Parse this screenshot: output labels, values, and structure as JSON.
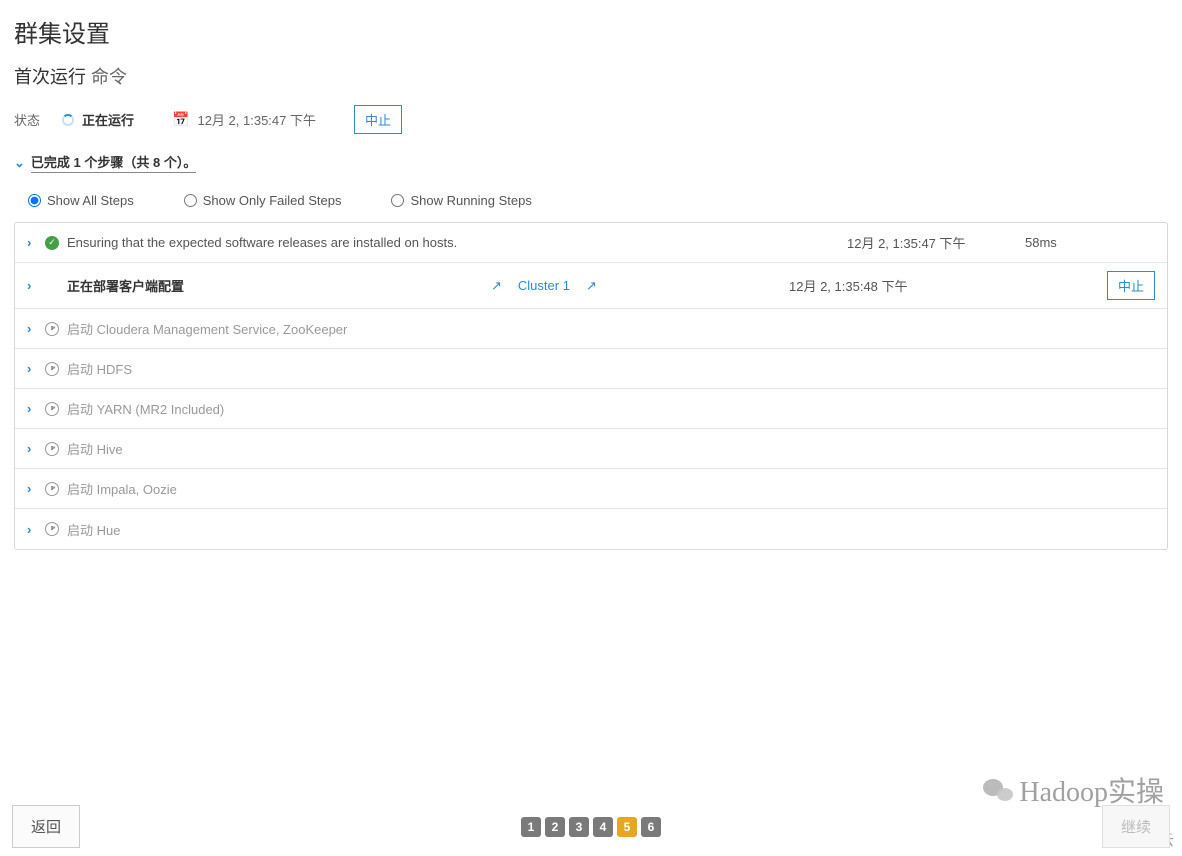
{
  "page": {
    "title": "群集设置",
    "subtitle_strong": "首次运行",
    "subtitle_light": "命令"
  },
  "status": {
    "label": "状态",
    "value": "正在运行",
    "timestamp": "12月 2, 1:35:47 下午",
    "abort_label": "中止"
  },
  "progress": {
    "text": "已完成 1 个步骤（共 8 个）。"
  },
  "filters": {
    "all": "Show All Steps",
    "failed": "Show Only Failed Steps",
    "running": "Show Running Steps"
  },
  "steps": [
    {
      "status": "done",
      "text": "Ensuring that the expected software releases are installed on hosts.",
      "link": "",
      "ts": "12月 2, 1:35:47 下午",
      "duration": "58ms",
      "abort": ""
    },
    {
      "status": "running",
      "text": "正在部署客户端配置",
      "link": "Cluster 1",
      "ts": "12月 2, 1:35:48 下午",
      "duration": "",
      "abort": "中止"
    },
    {
      "status": "pending",
      "text": "启动 Cloudera Management Service, ZooKeeper",
      "link": "",
      "ts": "",
      "duration": "",
      "abort": ""
    },
    {
      "status": "pending",
      "text": "启动 HDFS",
      "link": "",
      "ts": "",
      "duration": "",
      "abort": ""
    },
    {
      "status": "pending",
      "text": "启动 YARN (MR2 Included)",
      "link": "",
      "ts": "",
      "duration": "",
      "abort": ""
    },
    {
      "status": "pending",
      "text": "启动 Hive",
      "link": "",
      "ts": "",
      "duration": "",
      "abort": ""
    },
    {
      "status": "pending",
      "text": "启动 Impala, Oozie",
      "link": "",
      "ts": "",
      "duration": "",
      "abort": ""
    },
    {
      "status": "pending",
      "text": "启动 Hue",
      "link": "",
      "ts": "",
      "duration": "",
      "abort": ""
    }
  ],
  "pager": [
    "1",
    "2",
    "3",
    "4",
    "5",
    "6"
  ],
  "pager_active": "5",
  "bottom": {
    "back": "返回",
    "continue": "继续"
  },
  "watermark1": "Hadoop实操",
  "watermark2": "亿速云"
}
